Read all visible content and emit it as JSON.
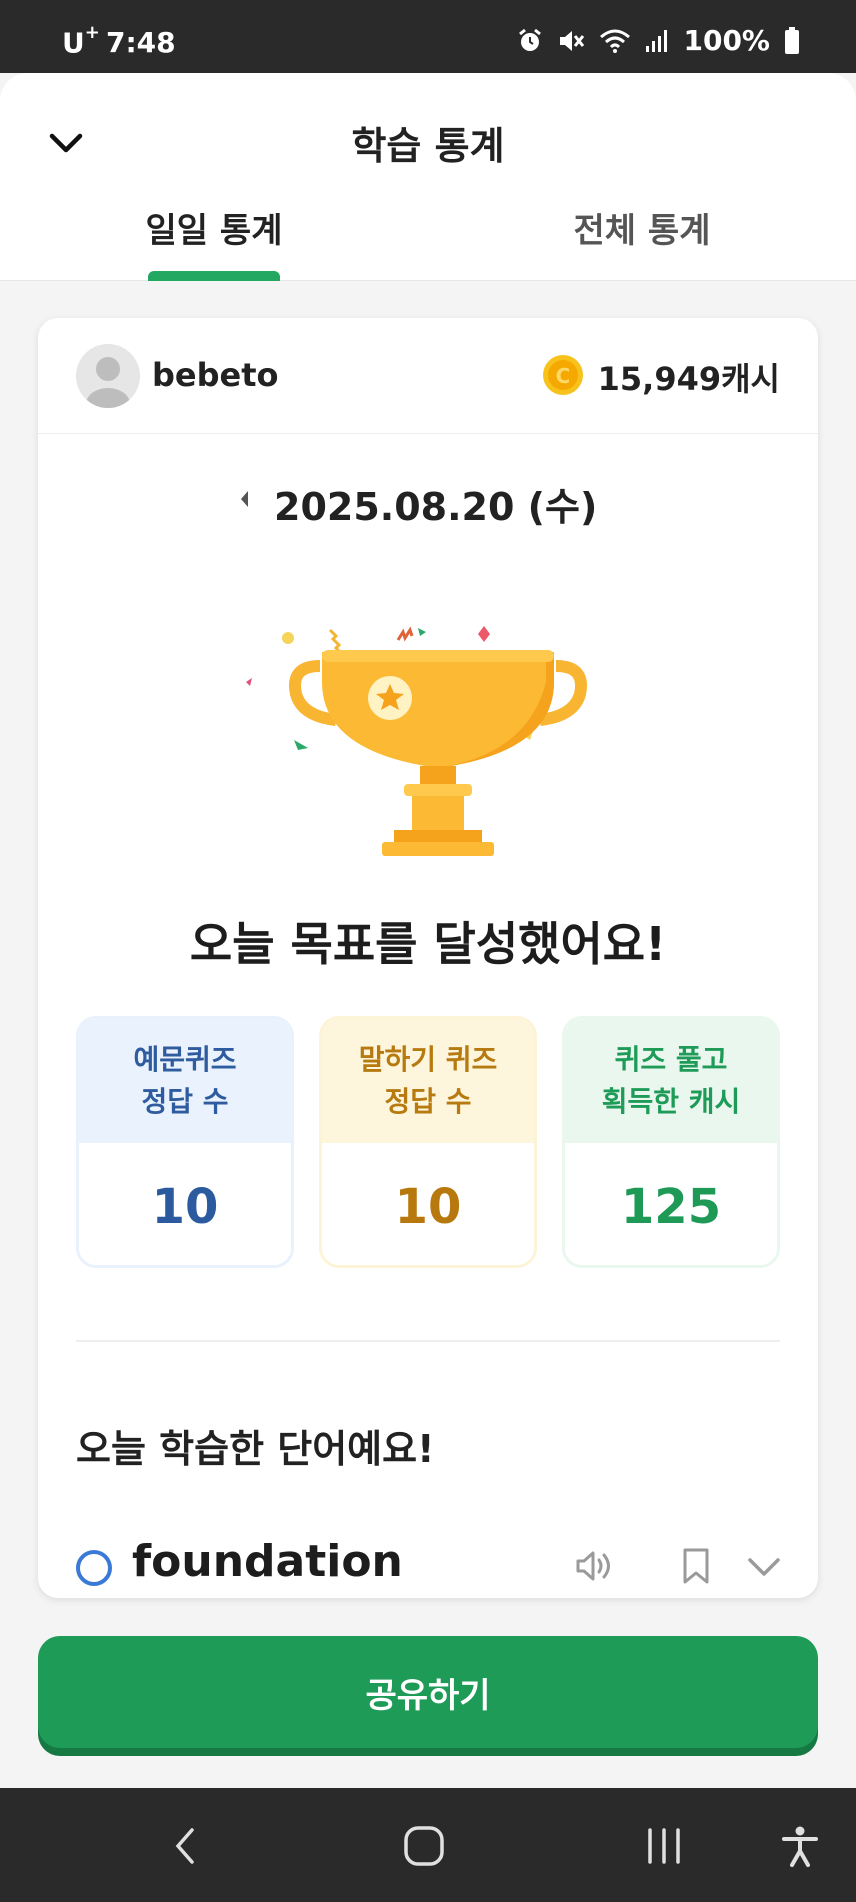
{
  "status_bar": {
    "carrier": "U",
    "carrier_plus": "+",
    "time": "7:48",
    "battery": "100%"
  },
  "header": {
    "title": "학습 통계",
    "tabs": [
      {
        "label": "일일 통계",
        "active": true
      },
      {
        "label": "전체 통계",
        "active": false
      }
    ]
  },
  "profile": {
    "username": "bebeto",
    "cash": "15,949캐시"
  },
  "date": "2025.08.20 (수)",
  "goal_message": "오늘 목표를 달성했어요!",
  "stats": [
    {
      "label_line1": "예문퀴즈",
      "label_line2": "정답 수",
      "value": "10"
    },
    {
      "label_line1": "말하기 퀴즈",
      "label_line2": "정답 수",
      "value": "10"
    },
    {
      "label_line1": "퀴즈 풀고",
      "label_line2": "획득한 캐시",
      "value": "125"
    }
  ],
  "words_section_title": "오늘 학습한 단어예요!",
  "words": [
    {
      "word": "foundation"
    }
  ],
  "share_button": "공유하기",
  "colors": {
    "brand_green": "#1f9b58",
    "blue": "#2b5b9e",
    "gold": "#b7780e",
    "coin": "#f5b400"
  }
}
